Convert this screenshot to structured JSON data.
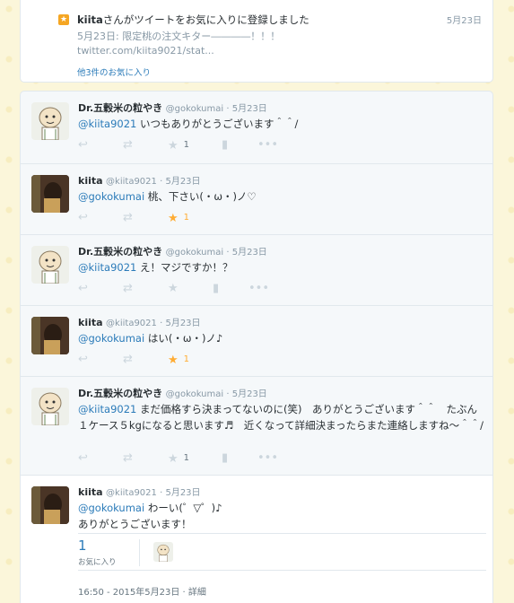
{
  "notification": {
    "user": "kiita",
    "message": "さんがツイートをお気に入りに登録しました",
    "date": "5月23日",
    "quote_line1": "5月23日: 限定桃の注文キター――――！！！",
    "quote_line2": "twitter.com/kiita9021/stat...",
    "more_link": "他3件のお気に入り"
  },
  "tweets": [
    {
      "name": "Dr.五穀米の粒やき",
      "handle": "@gokokumai",
      "date": "5月23日",
      "mention": "@kiita9021",
      "text": " いつもありがとうございます＾＾/",
      "fav_count": "1"
    },
    {
      "name": "kiita",
      "handle": "@kiita9021",
      "date": "5月23日",
      "mention": "@gokokumai",
      "text": " 桃、下さい(・ω・)ノ♡",
      "fav_count": "1"
    },
    {
      "name": "Dr.五穀米の粒やき",
      "handle": "@gokokumai",
      "date": "5月23日",
      "mention": "@kiita9021",
      "text": " え！マジですか！？",
      "fav_count": ""
    },
    {
      "name": "kiita",
      "handle": "@kiita9021",
      "date": "5月23日",
      "mention": "@gokokumai",
      "text": "  はい(・ω・)ノ♪",
      "fav_count": "1"
    },
    {
      "name": "Dr.五穀米の粒やき",
      "handle": "@gokokumai",
      "date": "5月23日",
      "mention": "@kiita9021",
      "text": " まだ価格すら決まってないのに(笑)　ありがとうございます＾＾　たぶん１ケース５kgになると思います♬　近くなって詳細決まったらまた連絡しますね～＾＾/",
      "fav_count": "1"
    },
    {
      "name": "kiita",
      "handle": "@kiita9021",
      "date": "5月23日",
      "mention": "@gokokumai",
      "text": " わーい(゜▽゜)♪",
      "line2": "ありがとうございます！"
    }
  ],
  "expanded": {
    "fav_count": "1",
    "fav_label": "お気に入り",
    "timestamp": "16:50 - 2015年5月23日 · 詳細"
  },
  "colors": {
    "link": "#2b7bb9",
    "star_active": "#ffac33",
    "muted": "#8899a6"
  }
}
